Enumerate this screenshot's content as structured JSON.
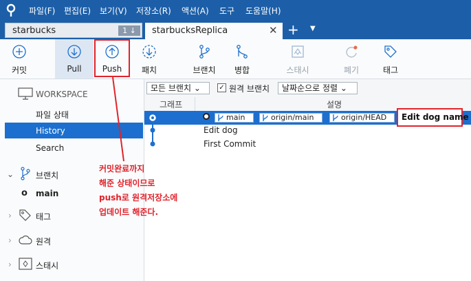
{
  "menu": [
    "파일(F)",
    "편집(E)",
    "보기(V)",
    "저장소(R)",
    "액션(A)",
    "도구",
    "도움말(H)"
  ],
  "tabs": [
    {
      "label": "starbucks",
      "badge": "1 ↓"
    },
    {
      "label": "starbucksReplica",
      "close": "✕"
    }
  ],
  "tab_add": "+",
  "tab_menu": "▼",
  "toolbar": {
    "commit": "커밋",
    "pull": "Pull",
    "push": "Push",
    "fetch": "패치",
    "branch": "브랜치",
    "merge": "병합",
    "stash": "스태시",
    "discard": "폐기",
    "tag": "태그"
  },
  "sidebar": {
    "workspace": "WORKSPACE",
    "file_status": "파일 상태",
    "history": "History",
    "search": "Search",
    "branches": "브랜치",
    "main_branch": "main",
    "tags": "태그",
    "remotes": "원격",
    "stashes": "스태시"
  },
  "filters": {
    "all_branches": "모든 브랜치 ⌄",
    "remote_branches": "원격 브랜치",
    "remote_checked": "✓",
    "sort": "날짜순으로 정렬 ⌄"
  },
  "columns": {
    "graph": "그래프",
    "description": "설명"
  },
  "commits": [
    {
      "message": "Edit dog name",
      "labels": [
        "main",
        "origin/main",
        "origin/HEAD"
      ]
    },
    {
      "message": "Edit dog"
    },
    {
      "message": "First Commit"
    }
  ],
  "annotation": [
    "커밋완료까지",
    "해준 상태이므로",
    "push로 원격저장소에",
    "업데이트 해준다."
  ],
  "colors": {
    "accent": "#1c5fa8",
    "selection": "#1c6fce",
    "highlight": "#e0232b"
  }
}
